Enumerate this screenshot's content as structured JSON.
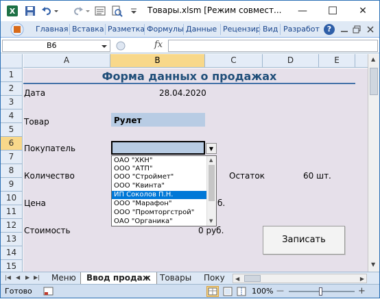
{
  "title_bar": {
    "title": "Товары.xlsm  [Режим совмест...",
    "minimize": "—",
    "maximize": "☐",
    "close": "✕"
  },
  "ribbon": {
    "tabs": [
      "Главная",
      "Вставка",
      "Разметка",
      "Формулы",
      "Данные",
      "Рецензир",
      "Вид",
      "Разработ"
    ],
    "help": "?"
  },
  "formula_bar": {
    "name_box": "B6",
    "fx": "fx",
    "value": ""
  },
  "columns": [
    "A",
    "B",
    "C",
    "D",
    "E"
  ],
  "rows": [
    "1",
    "2",
    "3",
    "4",
    "5",
    "6",
    "7",
    "8",
    "9",
    "10",
    "11",
    "12",
    "13",
    "14",
    "15"
  ],
  "selected_cell": "B6",
  "form": {
    "title": "Форма данных о продажах",
    "date_label": "Дата",
    "date_value": "28.04.2020",
    "product_label": "Товар",
    "product_value": "Рулет",
    "buyer_label": "Покупатель",
    "buyer_value": "",
    "quantity_label": "Количество",
    "stock_label": "Остаток",
    "stock_value": "60 шт.",
    "price_label": "Цена",
    "price_value": "б.",
    "cost_label": "Стоимость",
    "cost_value": "0 руб.",
    "save_button": "Записать"
  },
  "dropdown": {
    "items": [
      "ОАО \"ХКН\"",
      "ООО \"АТП\"",
      "ООО \"Строймет\"",
      "ООО \"Квинта\"",
      "ИП Соколов П.Н.",
      "ООО \"Марафон\"",
      "ООО \"Промторгстрой\"",
      "ОАО \"Органика\""
    ],
    "selected_index": 4
  },
  "sheet_tabs": [
    "Меню",
    "Ввод продаж",
    "Товары",
    "Поку"
  ],
  "active_sheet": "Ввод продаж",
  "status_bar": {
    "ready": "Готово",
    "zoom": "100%",
    "zoom_minus": "—",
    "zoom_plus": "+"
  },
  "colors": {
    "accent_title": "#1f4e79",
    "form_background": "#e6e0ea",
    "input_fill": "#b8cce4",
    "selection_highlight": "#0078d7",
    "header_selected": "#f8d88a"
  }
}
